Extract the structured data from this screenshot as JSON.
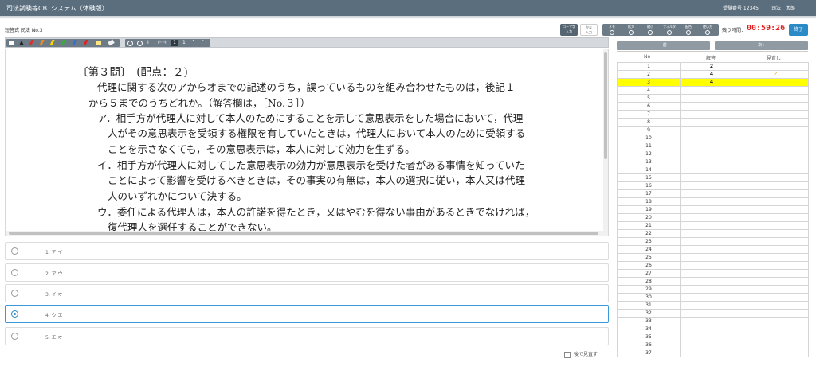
{
  "header": {
    "app_title": "司法試験等CBTシステム（体験版）",
    "exam_no": "受験番号 12345",
    "user_name": "司法　太郎"
  },
  "subject": "短答式 民法 No.3",
  "input_modes": {
    "romaji": [
      "ローマ字",
      "入力"
    ],
    "kana": [
      "かな",
      "入力"
    ]
  },
  "tools": [
    {
      "label": "メモ",
      "icon": "memo-icon"
    },
    {
      "label": "拡大",
      "icon": "zoom-in-icon"
    },
    {
      "label": "縮小",
      "icon": "zoom-out-icon"
    },
    {
      "label": "フィルタ",
      "icon": "filter-icon"
    },
    {
      "label": "配色",
      "icon": "color-scheme-icon"
    },
    {
      "label": "使い方",
      "icon": "help-icon"
    }
  ],
  "timer": {
    "label": "残り時間：",
    "value": "00:59:26"
  },
  "end_button": "終了",
  "doc_toolbar": {
    "pens": [
      {
        "icon": "hand-icon",
        "color": "#ffffff"
      },
      {
        "icon": "pointer-icon",
        "color": "#222222"
      },
      {
        "icon": "red-pen-icon",
        "color": "#d9302c"
      },
      {
        "icon": "orange-pen-icon",
        "color": "#f08c20"
      },
      {
        "icon": "yellow-pen-icon",
        "color": "#ffd800"
      },
      {
        "icon": "green-pen-icon",
        "color": "#3aaa3a"
      },
      {
        "icon": "blue-pen-icon",
        "color": "#2f6fd6"
      },
      {
        "icon": "red-marker-icon",
        "color": "#e02020"
      },
      {
        "icon": "note-icon",
        "color": "#ffe680"
      },
      {
        "icon": "eraser-icon",
        "color": "#f2f2f2"
      }
    ],
    "page": "1",
    "total_pages": "1"
  },
  "question": {
    "lines": [
      "〔第３問〕　(配点：２)",
      "代理に関する次のアからオまでの記述のうち，誤っているものを組み合わせたものは，後記１",
      "から５までのうちどれか。（解答欄は，［No.３］）",
      "ア．相手方が代理人に対して本人のためにすることを示して意思表示をした場合において，代理",
      "人がその意思表示を受領する権限を有していたときは，代理人において本人のために受領する",
      "ことを示さなくても，その意思表示は，本人に対して効力を生ずる。",
      "イ．相手方が代理人に対してした意思表示の効力が意思表示を受けた者がある事情を知っていた",
      "ことによって影響を受けるべきときは，その事実の有無は，本人の選択に従い，本人又は代理",
      "人のいずれかについて決する。",
      "ウ．委任による代理人は，本人の許諾を得たとき，又はやむを得ない事由があるときでなければ，",
      "復代理人を選任することができない。"
    ]
  },
  "choices": [
    {
      "label": "1. ア イ",
      "selected": false
    },
    {
      "label": "2. ア ウ",
      "selected": false
    },
    {
      "label": "3. イ オ",
      "selected": false
    },
    {
      "label": "4. ウ エ",
      "selected": true
    },
    {
      "label": "5. エ オ",
      "selected": false
    }
  ],
  "review_later": "後で見直す",
  "answer_sheet": {
    "prev_label": "‹ 前",
    "next_label": "次 ›",
    "headers": {
      "no": "No",
      "answer": "解答",
      "review": "見直し"
    },
    "rows": [
      {
        "no": "1",
        "answer": "2",
        "review": ""
      },
      {
        "no": "2",
        "answer": "4",
        "review": "✓"
      },
      {
        "no": "3",
        "answer": "4",
        "review": "",
        "current": true
      },
      {
        "no": "4",
        "answer": "",
        "review": ""
      },
      {
        "no": "5",
        "answer": "",
        "review": ""
      },
      {
        "no": "6",
        "answer": "",
        "review": ""
      },
      {
        "no": "7",
        "answer": "",
        "review": ""
      },
      {
        "no": "8",
        "answer": "",
        "review": ""
      },
      {
        "no": "9",
        "answer": "",
        "review": ""
      },
      {
        "no": "10",
        "answer": "",
        "review": ""
      },
      {
        "no": "11",
        "answer": "",
        "review": ""
      },
      {
        "no": "12",
        "answer": "",
        "review": ""
      },
      {
        "no": "13",
        "answer": "",
        "review": ""
      },
      {
        "no": "14",
        "answer": "",
        "review": ""
      },
      {
        "no": "15",
        "answer": "",
        "review": ""
      },
      {
        "no": "16",
        "answer": "",
        "review": ""
      },
      {
        "no": "17",
        "answer": "",
        "review": ""
      },
      {
        "no": "18",
        "answer": "",
        "review": ""
      },
      {
        "no": "19",
        "answer": "",
        "review": ""
      },
      {
        "no": "20",
        "answer": "",
        "review": ""
      },
      {
        "no": "21",
        "answer": "",
        "review": ""
      },
      {
        "no": "22",
        "answer": "",
        "review": ""
      },
      {
        "no": "23",
        "answer": "",
        "review": ""
      },
      {
        "no": "24",
        "answer": "",
        "review": ""
      },
      {
        "no": "25",
        "answer": "",
        "review": ""
      },
      {
        "no": "26",
        "answer": "",
        "review": ""
      },
      {
        "no": "27",
        "answer": "",
        "review": ""
      },
      {
        "no": "28",
        "answer": "",
        "review": ""
      },
      {
        "no": "29",
        "answer": "",
        "review": ""
      },
      {
        "no": "30",
        "answer": "",
        "review": ""
      },
      {
        "no": "31",
        "answer": "",
        "review": ""
      },
      {
        "no": "32",
        "answer": "",
        "review": ""
      },
      {
        "no": "33",
        "answer": "",
        "review": ""
      },
      {
        "no": "34",
        "answer": "",
        "review": ""
      },
      {
        "no": "35",
        "answer": "",
        "review": ""
      },
      {
        "no": "36",
        "answer": "",
        "review": ""
      },
      {
        "no": "37",
        "answer": "",
        "review": ""
      }
    ]
  }
}
